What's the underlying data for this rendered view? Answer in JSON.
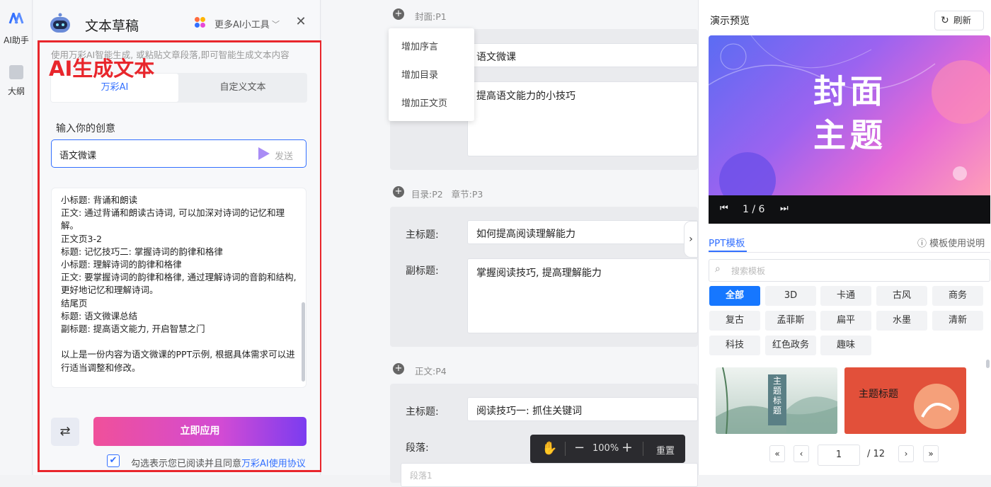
{
  "rail": {
    "ai_label": "AI助手",
    "outline_label": "大纲"
  },
  "panel": {
    "title": "文本草稿",
    "more_tools": "更多AI小工具",
    "hint": "使用万彩AI智能生成, 或粘贴文章段落,即可智能生成文本内容",
    "overlay_label": "AI生成文本",
    "tabs": [
      "万彩AI",
      "自定义文本"
    ],
    "idea_label": "输入你的创意",
    "idea_value": "语文微课",
    "send_label": "发送",
    "generated_text": "小标题: 背诵和朗读\n正文: 通过背诵和朗读古诗词, 可以加深对诗词的记忆和理解。\n正文页3-2\n标题: 记忆技巧二: 掌握诗词的韵律和格律\n小标题: 理解诗词的韵律和格律\n正文: 要掌握诗词的韵律和格律, 通过理解诗词的音韵和结构, 更好地记忆和理解诗词。\n结尾页\n标题: 语文微课总结\n副标题: 提高语文能力, 开启智慧之门\n\n以上是一份内容为语文微课的PPT示例, 根据具体需求可以进行适当调整和修改。",
    "apply_label": "立即应用",
    "agree_text": "勾选表示您已阅读并且同意",
    "agree_link": "万彩AI使用协议"
  },
  "editor": {
    "sec1_header": "封面:P1",
    "sec2_header": "目录:P2",
    "sec2_header_b": "章节:P3",
    "sec3_header": "正文:P4",
    "menu": [
      "增加序言",
      "增加目录",
      "增加正文页"
    ],
    "cover_title": "语文微课",
    "cover_sub": "提高语文能力的小技巧",
    "main_title_label": "主标题:",
    "sub_title_label": "副标题:",
    "toc_title": "如何提高阅读理解能力",
    "toc_sub": "掌握阅读技巧, 提高理解能力",
    "body_title": "阅读技巧一: 抓住关键词",
    "paragraph_label": "段落:",
    "paragraph_placeholder": "段落1",
    "zoom": "100%",
    "reset": "重置"
  },
  "preview": {
    "title": "演示预览",
    "refresh": "刷新",
    "slide_title_line1": "封面",
    "slide_title_line2": "主题",
    "slide_counter": "1 / 6",
    "tab_active": "PPT模板",
    "help": "模板使用说明",
    "search_placeholder": "搜索模板",
    "chips": [
      "全部",
      "3D",
      "卡通",
      "古风",
      "商务",
      "复古",
      "孟菲斯",
      "扁平",
      "水墨",
      "清新",
      "科技",
      "红色政务",
      "趣味"
    ],
    "thumb1_title": "主题标题",
    "thumb2_title": "主题标题",
    "page_current": "1",
    "page_total": "/ 12"
  }
}
